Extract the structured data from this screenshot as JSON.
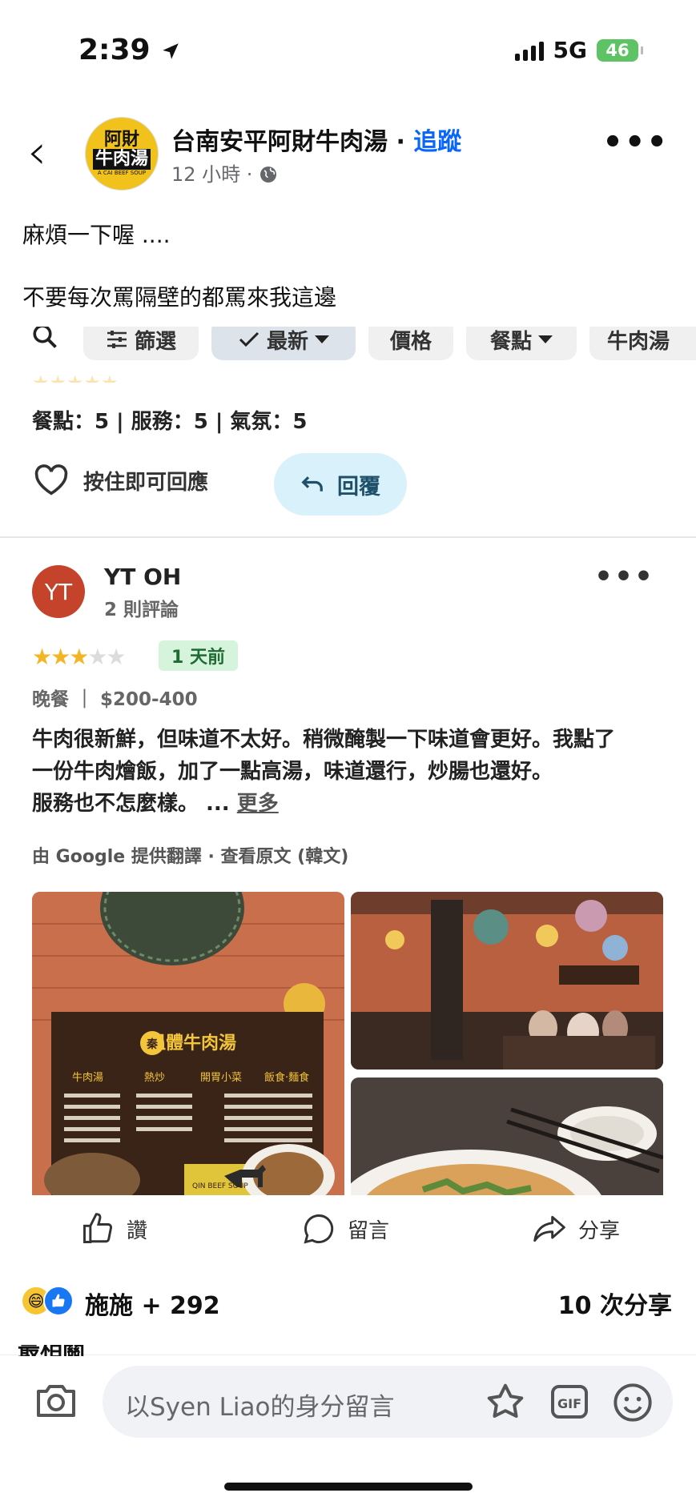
{
  "status_bar": {
    "time": "2:39",
    "network": "5G",
    "battery": "46"
  },
  "post": {
    "page_name": "台南安平阿財牛肉湯",
    "follow_sep": " · ",
    "follow_label": "追蹤",
    "time_ago": "12 小時 ·",
    "logo": {
      "line1": "阿財",
      "line2": "牛肉湯",
      "line3": "A CAI BEEF SOUP"
    },
    "text_lines": [
      "麻煩一下喔 ....",
      "不要每次罵隔壁的都罵來我這邊"
    ]
  },
  "screenshot": {
    "filters": {
      "filter": "篩選",
      "newest": "最新",
      "price": "價格",
      "meal": "餐點",
      "beef_soup": "牛肉湯"
    },
    "prev_review": {
      "ratings": "餐點：5 | 服務：5 | 氣氛：5",
      "like_hold": "按住即可回應",
      "reply": "回覆"
    },
    "review": {
      "avatar_initials": "YT",
      "name": "YT OH",
      "count": "2 則評論",
      "stars": 3,
      "age": "1 天前",
      "meal_price": "晚餐 ｜ $200-400",
      "line1": "牛肉很新鮮，但味道不太好。稍微醃製一下味道會更好。我點了",
      "line2": "一份牛肉燴飯，加了一點高湯，味道還行，炒腸也還好。",
      "line3": "服務也不怎麼樣。 ... ",
      "more": "更多",
      "translate": "由 Google 提供翻譯 · 查看原文 (韓文)"
    },
    "menu_photo": {
      "sign_title": "溫體牛肉湯",
      "columns": [
        "牛肉湯",
        "熱炒",
        "開胃小菜",
        "飯食·麵食"
      ],
      "brand": "QIN BEEF SOUP"
    }
  },
  "actions": {
    "like": "讚",
    "comment": "留言",
    "share": "分享"
  },
  "reactions": {
    "text": "施施 + 292",
    "shares": "10 次分享"
  },
  "composer": {
    "placeholder": "以Syen  Liao的身分留言"
  },
  "colors": {
    "accent": "#0866ff",
    "star": "#f3b526",
    "reply_bg": "#d9f1fa"
  }
}
